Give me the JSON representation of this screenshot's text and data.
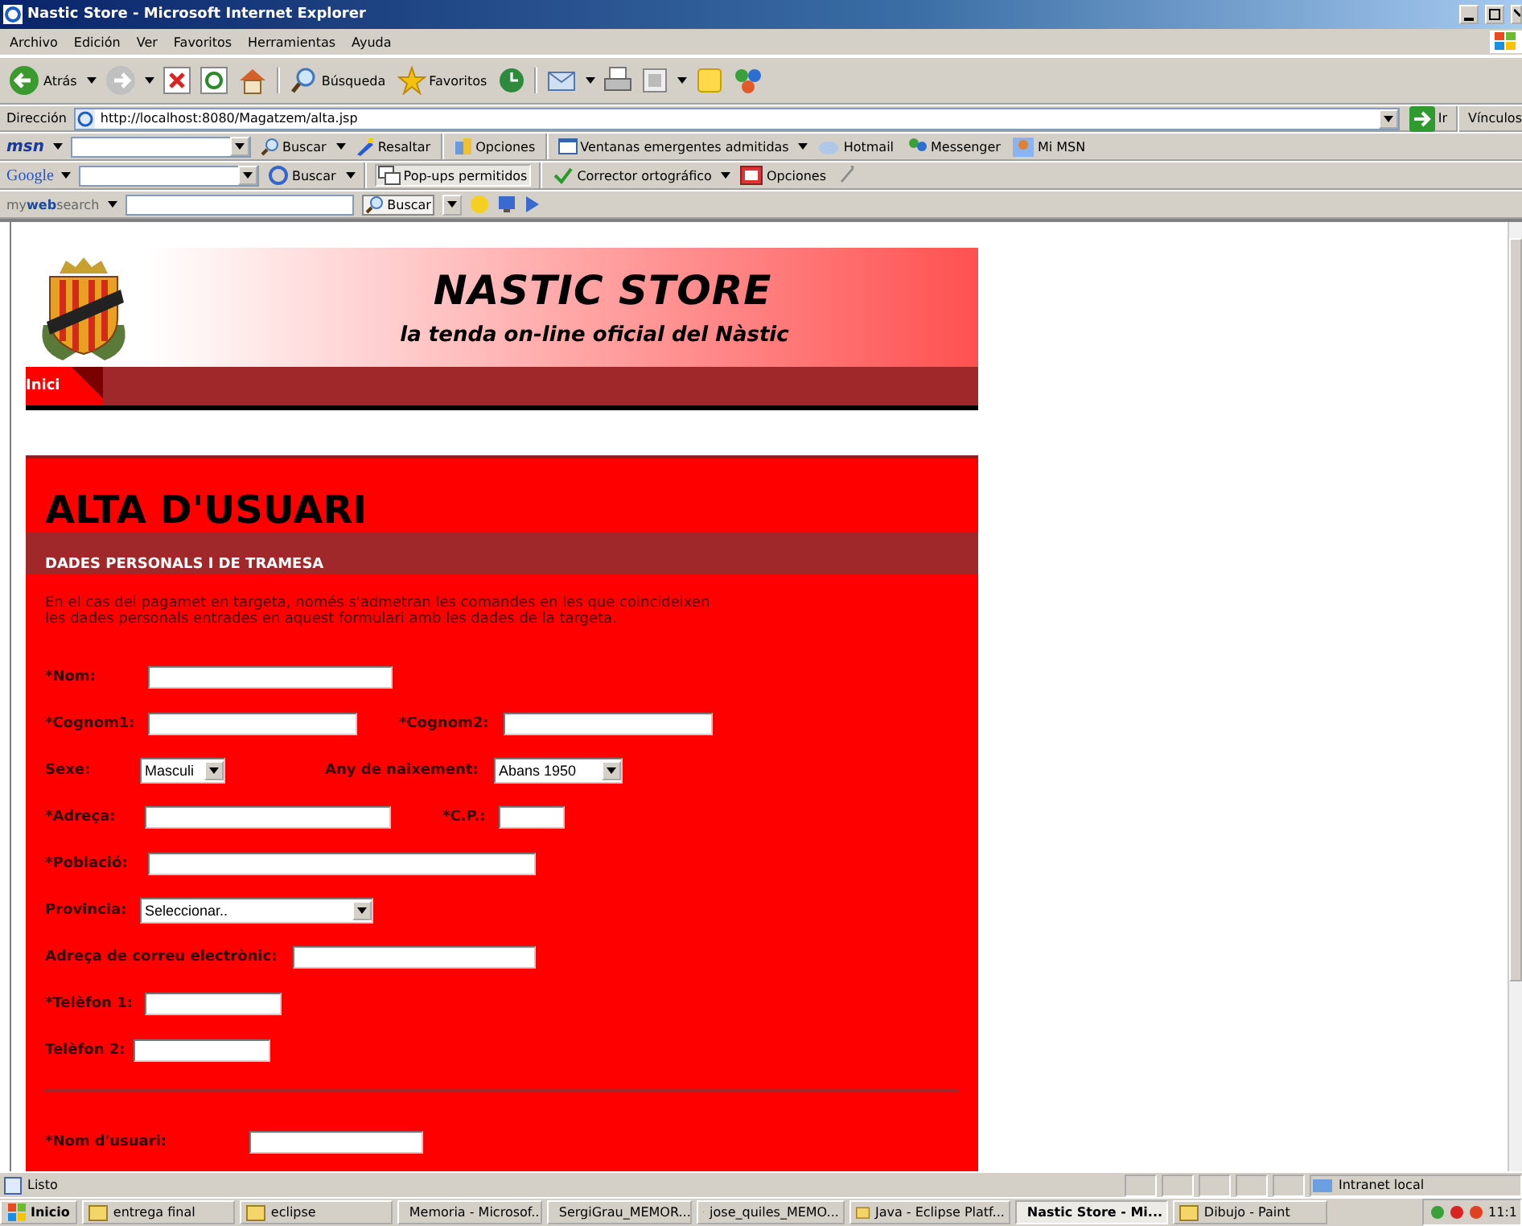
{
  "window": {
    "title": "Nastic Store - Microsoft Internet Explorer"
  },
  "menu": [
    "Archivo",
    "Edición",
    "Ver",
    "Favoritos",
    "Herramientas",
    "Ayuda"
  ],
  "toolbar": {
    "back": "Atrás",
    "search": "Búsqueda",
    "favorites": "Favoritos"
  },
  "address": {
    "label": "Dirección",
    "value": "http://localhost:8080/Magatzem/alta.jsp",
    "go": "Ir",
    "links": "Vínculos"
  },
  "msn_bar": {
    "logo": "msn",
    "search": "Buscar",
    "highlight": "Resaltar",
    "options": "Opciones",
    "popups": "Ventanas emergentes admitidas",
    "hotmail": "Hotmail",
    "messenger": "Messenger",
    "mymsn": "Mi MSN"
  },
  "google_bar": {
    "logo": "Google",
    "search": "Buscar",
    "popups": "Pop-ups permitidos",
    "spell": "Corrector ortográfico",
    "options": "Opciones"
  },
  "mywebsearch_bar": {
    "logo": "my**web**search",
    "search": "Buscar"
  },
  "page": {
    "header": {
      "title": "NASTIC STORE",
      "subtitle": "la tenda on-line oficial del Nàstic"
    },
    "nav": [
      {
        "label": "Inici",
        "selected": true
      }
    ],
    "form": {
      "title": "ALTA D'USUARI",
      "section": "DADES PERSONALS I DE TRAMESA",
      "note": [
        "En el cas del pagamet en targeta, només s'admetran les comandes en les que coincideixen",
        "les dades personals entrades en aquest formulari amb les dades de la targeta."
      ],
      "rows": [
        {
          "kind": "fields",
          "fields": [
            {
              "label": "*Nom:",
              "kind": "text"
            }
          ]
        },
        {
          "kind": "fields",
          "fields": [
            {
              "label": "*Cognom1:",
              "kind": "text"
            },
            {
              "label": "*Cognom2:",
              "kind": "text"
            }
          ]
        },
        {
          "kind": "fields",
          "fields": [
            {
              "label": "Sexe:",
              "kind": "select",
              "value": "Masculi"
            },
            {
              "label": "Any de naixement:",
              "kind": "select",
              "value": "Abans 1950"
            }
          ]
        },
        {
          "kind": "fields",
          "fields": [
            {
              "label": "*Adreça:",
              "kind": "text"
            },
            {
              "label": "*C.P.:",
              "kind": "text"
            }
          ]
        },
        {
          "kind": "fields",
          "fields": [
            {
              "label": "*Població:",
              "kind": "text"
            }
          ]
        },
        {
          "kind": "fields",
          "fields": [
            {
              "label": "Provincia:",
              "kind": "select",
              "value": "Seleccionar.."
            }
          ]
        },
        {
          "kind": "fields",
          "fields": [
            {
              "label": "Adreça de correu electrònic:",
              "kind": "text"
            }
          ]
        },
        {
          "kind": "fields",
          "fields": [
            {
              "label": "*Telèfon 1:",
              "kind": "text"
            }
          ]
        },
        {
          "kind": "fields",
          "fields": [
            {
              "label": "Telèfon 2:",
              "kind": "text"
            }
          ]
        },
        {
          "kind": "divider"
        },
        {
          "kind": "fields",
          "fields": [
            {
              "label": "*Nom d'usuari:",
              "kind": "text"
            }
          ]
        }
      ]
    }
  },
  "status_bar": {
    "text": "Listo",
    "zone": "Intranet local"
  },
  "taskbar": {
    "start": "Inicio",
    "tasks": [
      {
        "label": "entrega final",
        "selected": false
      },
      {
        "label": "eclipse",
        "selected": false
      },
      {
        "label": "Memoria - Microsof...",
        "selected": false
      },
      {
        "label": "SergiGrau_MEMOR...",
        "selected": false
      },
      {
        "label": "jose_quiles_MEMO...",
        "selected": false
      },
      {
        "label": "Java - Eclipse Platf...",
        "selected": false
      },
      {
        "label": "Nastic Store - Mi...",
        "selected": true
      },
      {
        "label": "Dibujo - Paint",
        "selected": false
      }
    ],
    "clock": "11:1"
  }
}
